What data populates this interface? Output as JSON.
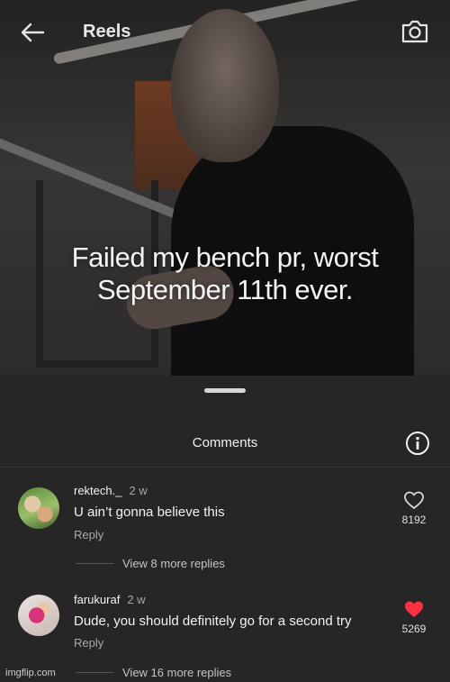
{
  "header": {
    "title": "Reels"
  },
  "video": {
    "caption_lines": [
      "Failed my bench pr, worst",
      "September 11th ever."
    ]
  },
  "comments_sheet": {
    "title": "Comments",
    "comments": [
      {
        "username": "rektech._",
        "time": "2 w",
        "text": "U ain’t gonna believe this",
        "reply_label": "Reply",
        "view_replies": "View 8 more replies",
        "likes": "8192",
        "liked": false
      },
      {
        "username": "farukuraf",
        "time": "2 w",
        "text": "Dude, you should definitely go for a second try",
        "reply_label": "Reply",
        "view_replies": "View 16 more replies",
        "likes": "5269",
        "liked": true
      }
    ]
  },
  "watermark": "imgflip.com",
  "colors": {
    "background": "#262626",
    "like_red": "#ff3040",
    "muted_text": "#a8a8a8"
  },
  "icons": [
    "back-arrow-icon",
    "camera-icon",
    "info-icon",
    "heart-outline-icon",
    "heart-filled-icon"
  ]
}
